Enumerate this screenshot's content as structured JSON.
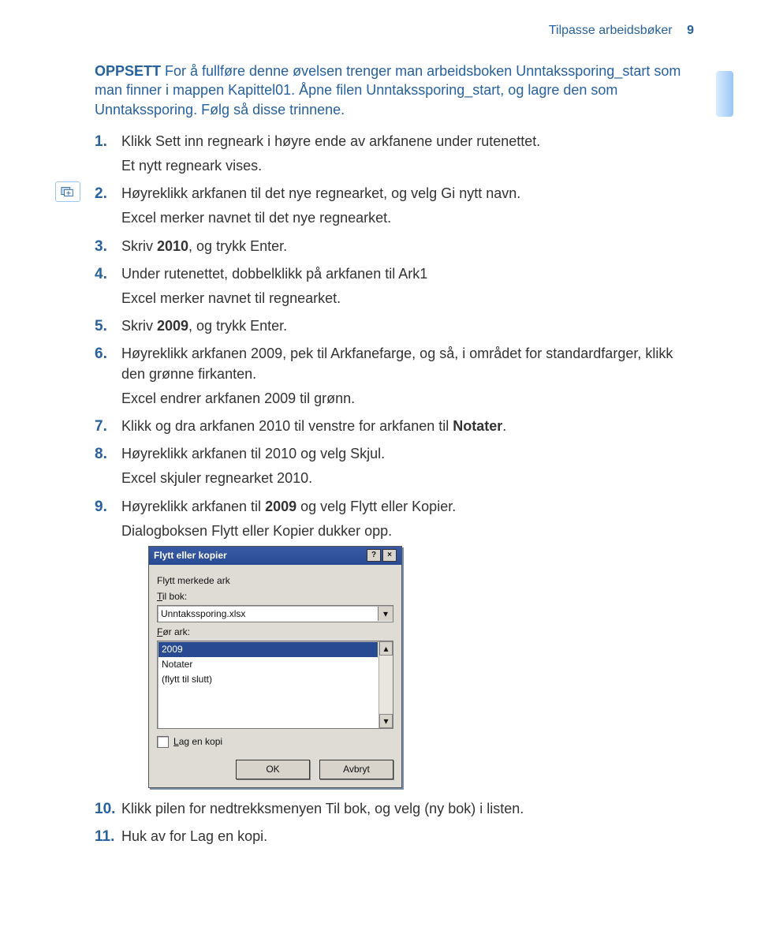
{
  "header": {
    "title": "Tilpasse arbeidsbøker",
    "page_number": "9"
  },
  "setup": {
    "label": "OPPSETT",
    "text": " For å fullføre denne øvelsen trenger man arbeidsboken Unntakssporing_start som man finner i mappen Kapittel01. Åpne filen Unntakssporing_start, og lagre den som Unntakssporing. Følg så disse trinnene."
  },
  "steps": [
    {
      "n": "1.",
      "text": "Klikk Sett inn regneark i høyre ende av arkfanene under rutenettet.",
      "result": "Et nytt regneark vises."
    },
    {
      "n": "2.",
      "text": "Høyreklikk arkfanen til det nye regnearket, og velg Gi nytt navn.",
      "result": "Excel merker navnet til det nye regnearket."
    },
    {
      "n": "3.",
      "pre": "Skriv ",
      "bold": "2010",
      "post": ", og trykk Enter."
    },
    {
      "n": "4.",
      "text": "Under rutenettet, dobbelklikk på arkfanen til Ark1",
      "result": "Excel merker navnet til regnearket."
    },
    {
      "n": "5.",
      "pre": "Skriv ",
      "bold": "2009",
      "post": ", og trykk Enter."
    },
    {
      "n": "6.",
      "text": "Høyreklikk arkfanen 2009, pek til Arkfanefarge, og så, i området for standardfarger, klikk den grønne firkanten.",
      "result": "Excel endrer arkfanen 2009 til grønn."
    },
    {
      "n": "7.",
      "pre": "Klikk og dra arkfanen 2010 til venstre for arkfanen til ",
      "bold": "Notater",
      "post": "."
    },
    {
      "n": "8.",
      "text": "Høyreklikk arkfanen til 2010 og velg Skjul.",
      "result": "Excel skjuler regnearket 2010."
    },
    {
      "n": "9.",
      "pre": "Høyreklikk arkfanen til ",
      "bold": "2009",
      "post": " og velg Flytt eller Kopier.",
      "result": "Dialogboksen Flytt eller Kopier dukker opp."
    },
    {
      "n": "10.",
      "text": "Klikk pilen for nedtrekksmenyen Til bok, og velg (ny bok) i listen."
    },
    {
      "n": "11.",
      "text": "Huk av for Lag en kopi."
    }
  ],
  "dialog": {
    "title": "Flytt eller kopier",
    "help_glyph": "?",
    "close_glyph": "×",
    "move_label": "Flytt merkede ark",
    "to_book_label_u": "T",
    "to_book_label_rest": "il bok:",
    "to_book_value": "Unntakssporing.xlsx",
    "before_label_u": "F",
    "before_label_rest": "ør ark:",
    "list": [
      "2009",
      "Notater",
      "(flytt til slutt)"
    ],
    "selected_index": 0,
    "copy_label_u": "L",
    "copy_label_rest": "ag en kopi",
    "ok": "OK",
    "cancel": "Avbryt",
    "caret_down": "▾",
    "caret_up": "▴"
  },
  "margin_icon_name": "worksheet-insert-icon"
}
